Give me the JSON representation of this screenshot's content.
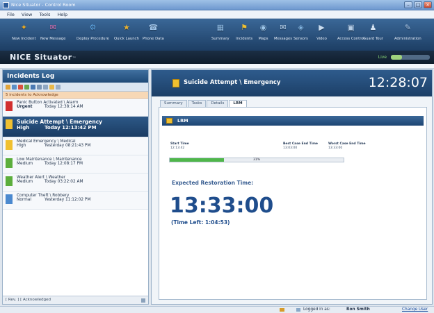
{
  "window": {
    "title": "Nice Situator - Control Room",
    "controls": [
      "–",
      "□",
      "×"
    ]
  },
  "menu": [
    "File",
    "View",
    "Tools",
    "Help"
  ],
  "toolbar": {
    "left": [
      {
        "label": "New Incident",
        "icon": "new-incident-icon",
        "glyph": "✦",
        "color": "#e8a821"
      },
      {
        "label": "New Message",
        "icon": "new-message-icon",
        "glyph": "✉",
        "color": "#d66fb0"
      },
      {
        "label": "Deploy Procedure",
        "icon": "deploy-procedure-icon",
        "glyph": "⚙",
        "color": "#5fa8e6"
      },
      {
        "label": "Quick Launch",
        "icon": "quick-launch-icon",
        "glyph": "★",
        "color": "#e8b030"
      },
      {
        "label": "Phone Data",
        "icon": "phone-data-icon",
        "glyph": "☎",
        "color": "#9fc4e8"
      }
    ],
    "right": [
      {
        "label": "Summary",
        "icon": "summary-icon",
        "glyph": "▦",
        "color": "#8cb8e0"
      },
      {
        "label": "Incidents",
        "icon": "incidents-icon",
        "glyph": "⚑",
        "color": "#f0c030"
      },
      {
        "label": "Maps",
        "icon": "maps-icon",
        "glyph": "◉",
        "color": "#9cc5e8"
      },
      {
        "label": "Messages",
        "icon": "messages-icon",
        "glyph": "✉",
        "color": "#b9d3ec"
      },
      {
        "label": "Sensors",
        "icon": "sensors-icon",
        "glyph": "◈",
        "color": "#7fb2e0"
      },
      {
        "label": "Video",
        "icon": "video-icon",
        "glyph": "▶",
        "color": "#c9dcef"
      },
      {
        "label": "Access Control",
        "icon": "access-control-icon",
        "glyph": "▣",
        "color": "#b5cde6"
      },
      {
        "label": "Guard Tour",
        "icon": "guard-tour-icon",
        "glyph": "♟",
        "color": "#d3e2f2"
      },
      {
        "label": "Administration",
        "icon": "administration-icon",
        "glyph": "✎",
        "color": "#a7c3e2"
      }
    ]
  },
  "brand": {
    "name": "NICE Situator",
    "tm": "™",
    "live": "Live",
    "level": 0.28
  },
  "incidents_log": {
    "title": "Incidents Log",
    "ack_banner": "5 incidents to Acknowledge",
    "items": [
      {
        "name": "Panic Button Activated \\ Alarm",
        "priority": "Urgent",
        "time": "Today 12:38:14 AM",
        "flag": "#d22f2f",
        "selected": false,
        "urgent": true
      },
      {
        "name": "Suicide Attempt \\ Emergency",
        "priority": "High",
        "time": "Today 12:13:42 PM",
        "flag": "#f0c030",
        "selected": true,
        "urgent": false
      },
      {
        "name": "Medical Emergency \\ Medical",
        "priority": "High",
        "time": "Yesterday 08:21:43 PM",
        "flag": "#f0c030",
        "selected": false,
        "urgent": false
      },
      {
        "name": "Low Maintenance \\ Maintenance",
        "priority": "Medium",
        "time": "Today 12:08:17 PM",
        "flag": "#5cae3c",
        "selected": false,
        "urgent": false
      },
      {
        "name": "Weather Alert \\ Weather",
        "priority": "Medium",
        "time": "Today 03:22:02 AM",
        "flag": "#5cae3c",
        "selected": false,
        "urgent": false
      },
      {
        "name": "Computer Theft \\ Robbery",
        "priority": "Normal",
        "time": "Yesterday 11:12:02 PM",
        "flag": "#4b89cf",
        "selected": false,
        "urgent": false
      }
    ],
    "footer": "[ Rev. ]  [ Acknowledged"
  },
  "detail": {
    "title": "Suicide Attempt \\ Emergency",
    "clock": "12:28:07",
    "tabs": [
      "Summary",
      "Tasks",
      "Details",
      "LRM"
    ],
    "active_tab": "LRM",
    "section": "LRM",
    "timeline": {
      "start_label": "Start Time",
      "start_time": "12:13:42",
      "best_label": "Best Case End Time",
      "best_time": "13:03:00",
      "worst_label": "Worst Case End Time",
      "worst_time": "13:33:00"
    },
    "progress_percent": 31,
    "progress_label": "31%",
    "expected_label": "Expected Restoration Time:",
    "expected_time": "13:33:00",
    "time_left": "(Time Left: 1:04:53)"
  },
  "statusbar": {
    "logged_in_label": "Logged in as:",
    "user": "Ron Smith",
    "change_user": "Change User"
  }
}
